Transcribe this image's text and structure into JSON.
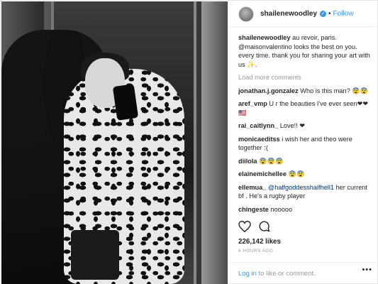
{
  "post": {
    "username": "shailenewoodley",
    "follow_label": "Follow",
    "separator": "•",
    "verified_icon": "verified-badge-icon",
    "caption": {
      "user": "shailenewoodley",
      "text_1": "au revoir, paris.",
      "mention": "@maisonvalentino",
      "text_2": "looks the best on you. every time. thank you for sharing your art with us ✨."
    },
    "load_more": "Load more comments",
    "comments": [
      {
        "user": "jonathan.j.gonzalez",
        "text": "Who is this man? 😨😨"
      },
      {
        "user": "aref_vmp",
        "text": "U r the beauties I've ever seen❤❤🇺🇸"
      },
      {
        "user": "rai_caitlynn_",
        "text": "Love!! ❤"
      },
      {
        "user": "monicaeditss",
        "text": "i wish her and theo were together :("
      },
      {
        "user": "diilola",
        "text": "😨😨😨"
      },
      {
        "user": "elainemichellee",
        "text": "😨😨"
      },
      {
        "user": "ellemua_",
        "mention": "@halfgoddesshalfhell1",
        "text": "her current bf . He's a rugby player"
      },
      {
        "user": "chingeste",
        "text": "nooooo"
      }
    ],
    "likes": "226,142 likes",
    "time": "6 HOURS AGO",
    "login_link": "Log in",
    "login_rest": "to like or comment.",
    "more_icon": "more-options-icon",
    "more_glyph": "•••"
  }
}
